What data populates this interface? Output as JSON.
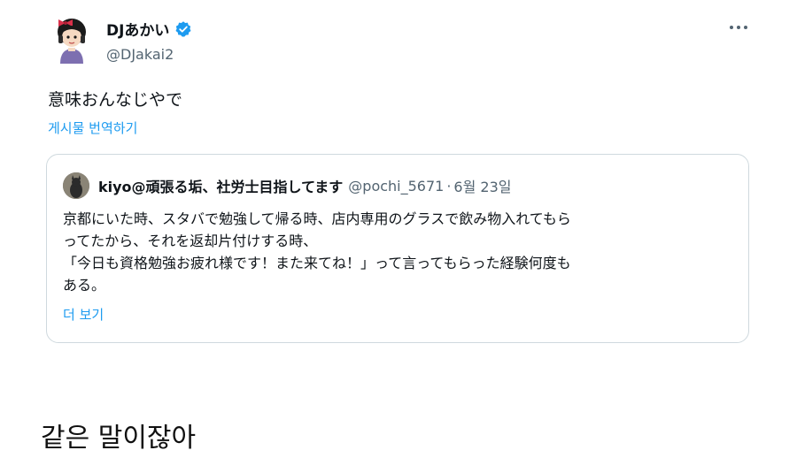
{
  "tweet": {
    "author_name": "DJあかい",
    "author_handle": "@DJakai2",
    "more_icon": "more-horizontal-icon",
    "verified_icon": "verified-badge-icon",
    "text": "意味おんなじやで",
    "translate_label": "게시물 번역하기"
  },
  "quote": {
    "name": "kiyo@頑張る垢、社労士目指してます",
    "handle": "@pochi_5671",
    "separator": "·",
    "date": "6월 23일",
    "lines": [
      "京都にいた時、スタバで勉強して帰る時、店内専用のグラスで飲み物入れてもら",
      "ってたから、それを返却片付けする時、",
      "「今日も資格勉強お疲れ様です！また来てね！」って言ってもらった経験何度も",
      "ある。"
    ],
    "show_more_label": "더 보기"
  },
  "caption": "같은 말이잖아",
  "colors": {
    "link": "#1d9bf0",
    "secondary": "#536471",
    "border": "#cfd9de"
  }
}
